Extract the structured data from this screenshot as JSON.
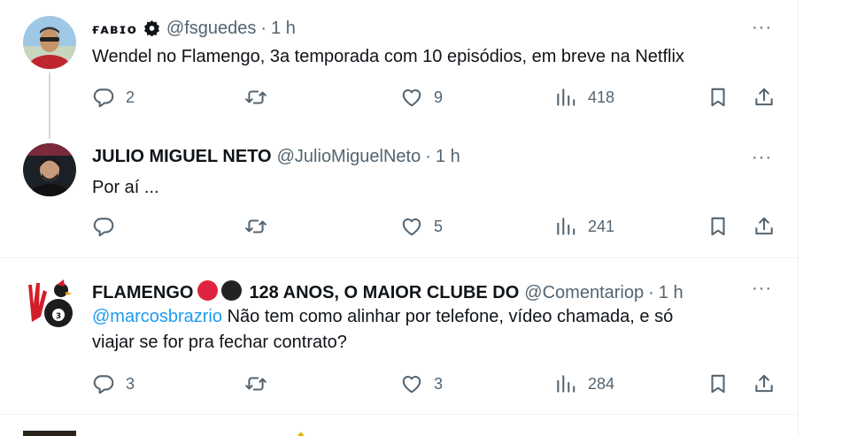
{
  "colors": {
    "accent": "#1d9bf0",
    "muted": "#536471",
    "text": "#0f1419",
    "club_red": "#e0243f",
    "club_black": "#222222"
  },
  "tweets": [
    {
      "name": "ғᴀʙɪᴏ",
      "handle": "@fsguedes",
      "dot": "·",
      "time": "1 h",
      "text": "Wendel no Flamengo, 3a temporada com 10 episódios, em breve na Netflix",
      "replies": "2",
      "likes": "9",
      "views": "418",
      "more": "···"
    },
    {
      "name": "JULIO MIGUEL NETO",
      "handle": "@JulioMiguelNeto",
      "dot": "·",
      "time": "1 h",
      "text": "Por aí ...",
      "replies": "",
      "likes": "5",
      "views": "241",
      "more": "···"
    },
    {
      "name_part1": "FLAMENGO",
      "name_part2": "128 ANOS, O MAIOR CLUBE DO",
      "handle": "@Comentariop",
      "dot": "·",
      "time": "1 h",
      "mention": "@marcosbrazrio",
      "text_line1": " Não tem como alinhar por telefone, vídeo chamada, e só",
      "text_line2": "viajar se for pra fechar contrato?",
      "replies": "3",
      "likes": "3",
      "views": "284",
      "more": "···"
    }
  ]
}
